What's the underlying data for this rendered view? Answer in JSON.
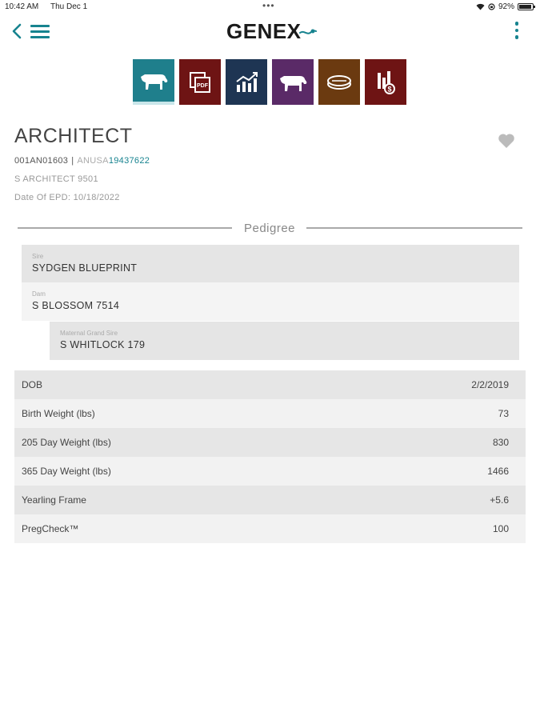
{
  "status_bar": {
    "time": "10:42 AM",
    "date": "Thu Dec 1",
    "battery": "92%",
    "battery_level": 0.92
  },
  "header": {
    "logo": "GENEX"
  },
  "tiles": [
    {
      "icon": "cow-icon",
      "color": "#1f7f8c"
    },
    {
      "icon": "pdf-documents-icon",
      "color": "#6e1414"
    },
    {
      "icon": "bar-chart-growth-icon",
      "color": "#1e3553"
    },
    {
      "icon": "cow-icon",
      "color": "#5a2a67"
    },
    {
      "icon": "straw-icon",
      "color": "#6b3a10"
    },
    {
      "icon": "price-chart-icon",
      "color": "#6e1414"
    }
  ],
  "bull": {
    "name": "ARCHITECT",
    "code": "001AN01603",
    "separator": "|",
    "reg_prefix": "ANUSA",
    "reg_number": "19437622",
    "registered_name": "S ARCHITECT 9501",
    "epd_date": "Date Of EPD: 10/18/2022"
  },
  "pedigree": {
    "title": "Pedigree",
    "sire_label": "Sire",
    "sire": "SYDGEN BLUEPRINT",
    "dam_label": "Dam",
    "dam": "S BLOSSOM 7514",
    "mgs_label": "Maternal Grand Sire",
    "mgs": "S WHITLOCK 179"
  },
  "stats": [
    {
      "label": "DOB",
      "value": "2/2/2019"
    },
    {
      "label": "Birth Weight (lbs)",
      "value": "73"
    },
    {
      "label": "205 Day Weight (lbs)",
      "value": "830"
    },
    {
      "label": "365 Day Weight (lbs)",
      "value": "1466"
    },
    {
      "label": "Yearling Frame",
      "value": "+5.6"
    },
    {
      "label": "PregCheck™",
      "value": "100"
    }
  ],
  "colors": {
    "accent": "#17838f"
  }
}
